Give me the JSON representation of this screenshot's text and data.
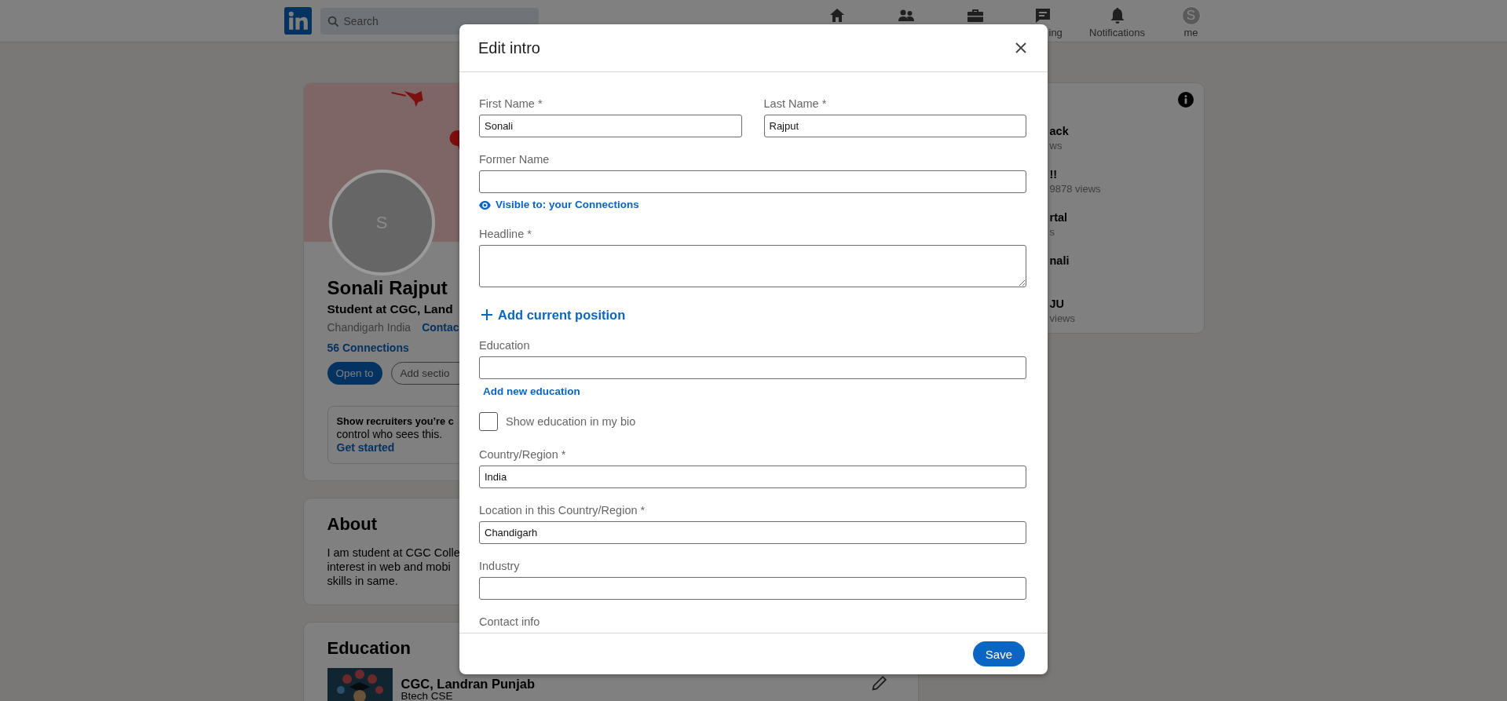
{
  "top_bar": {
    "search": {
      "placeholder": "Search"
    },
    "nav": [
      {
        "kind": "home"
      },
      {
        "kind": "network"
      },
      {
        "kind": "jobs"
      },
      {
        "kind": "messaging",
        "label": "ing"
      },
      {
        "kind": "notifications",
        "label": "Notifications"
      },
      {
        "kind": "me",
        "avatar_letter": "S",
        "label": "me"
      }
    ]
  },
  "profile": {
    "avatar_letter": "S",
    "name": "Sonali Rajput",
    "headline": "Student at CGC, Land",
    "location": "Chandigarh India",
    "contact_link": "Contac",
    "connections": "56 Connections",
    "buttons": [
      {
        "label": "Open to",
        "kind": "primary"
      },
      {
        "label": "Add sectio",
        "kind": "outline"
      }
    ],
    "recruiter": {
      "title": "Show recruiters you’re c",
      "text": "control who sees this.",
      "link": "Get started"
    }
  },
  "about": {
    "title": "About",
    "lines": [
      "I am student at CGC Colle",
      "interest in web and mobi",
      "skills in same."
    ]
  },
  "education": {
    "title": "Education",
    "entries": [
      {
        "school": "CGC, Landran Punjab",
        "degree": "Btech CSE"
      }
    ]
  },
  "side_card": {
    "items": [
      {
        "title": "ack",
        "subtitle": "ws"
      },
      {
        "title": "!!",
        "subtitle": "9878 views"
      },
      {
        "title": "rtal",
        "subtitle": "s"
      },
      {
        "title": "nali"
      },
      {
        "title": "JU",
        "subtitle": "views"
      }
    ]
  },
  "modal": {
    "title": "Edit intro",
    "sections": [
      {
        "kind": "pair",
        "fields": [
          {
            "label": "First Name *",
            "value": "Sonali"
          },
          {
            "label": "Last Name *",
            "value": "Rajput"
          }
        ]
      },
      {
        "kind": "input",
        "label": "Former Name"
      },
      {
        "kind": "visibility",
        "text": "Visible to: your Connections"
      },
      {
        "kind": "textarea",
        "label": "Headline *"
      },
      {
        "kind": "add",
        "text": "Add current position"
      },
      {
        "kind": "input",
        "label": "Education"
      },
      {
        "kind": "link",
        "text": "Add new education"
      },
      {
        "kind": "checkbox",
        "label": "Show education in my bio",
        "checked": false
      },
      {
        "kind": "input",
        "label": "Country/Region *",
        "value": "India"
      },
      {
        "kind": "input",
        "label": "Location in this Country/Region *",
        "value": "Chandigarh"
      },
      {
        "kind": "input",
        "label": "Industry"
      },
      {
        "kind": "heading",
        "label": "Contact info"
      }
    ],
    "save": "Save"
  }
}
